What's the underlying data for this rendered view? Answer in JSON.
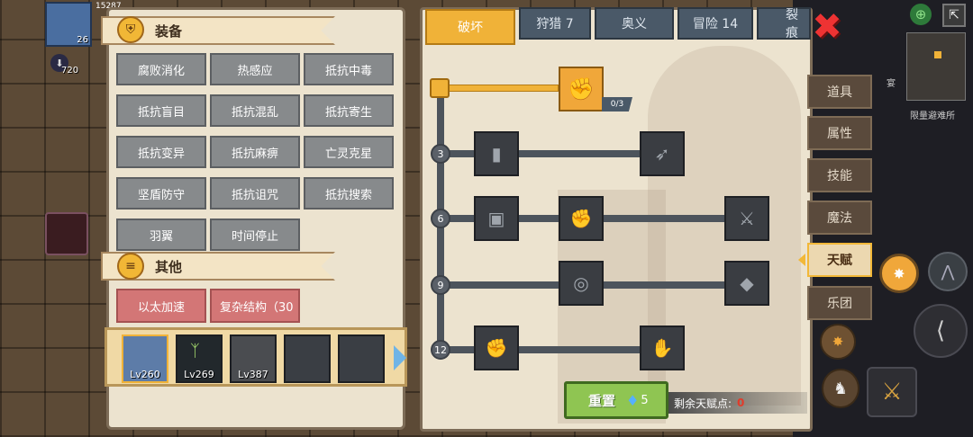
{
  "top_left": {
    "avatar_level": "26",
    "stat_value": "720",
    "hp_text": "15287"
  },
  "equip_section": {
    "title": "装备",
    "buttons": [
      "腐败消化",
      "热感应",
      "抵抗中毒",
      "抵抗盲目",
      "抵抗混乱",
      "抵抗寄生",
      "抵抗变异",
      "抵抗麻痹",
      "亡灵克星",
      "坚盾防守",
      "抵抗诅咒",
      "抵抗搜索",
      "羽翼",
      "时间停止"
    ]
  },
  "other_section": {
    "title": "其他",
    "buttons": [
      "以太加速",
      "复杂结构（30"
    ]
  },
  "heroes": [
    {
      "level": "Lv260"
    },
    {
      "level": "Lv269"
    },
    {
      "level": "Lv387"
    }
  ],
  "talent_tabs": [
    "破坏",
    "狩猎 7",
    "奥义",
    "冒险 14",
    "裂痕"
  ],
  "talent_tree": {
    "top_node_count": "0/3",
    "tiers": [
      "3",
      "6",
      "9",
      "12"
    ]
  },
  "reset": {
    "label": "重置",
    "cost": "5"
  },
  "remaining": {
    "label": "剩余天赋点:",
    "value": "0"
  },
  "side_tabs": [
    "道具",
    "属性",
    "技能",
    "魔法",
    "天赋",
    "乐团"
  ],
  "minimap": {
    "label": "限量避难所",
    "top_text": "宴"
  },
  "colors": {
    "accent": "#f0b238",
    "remaining_value": "#e23b2a"
  }
}
